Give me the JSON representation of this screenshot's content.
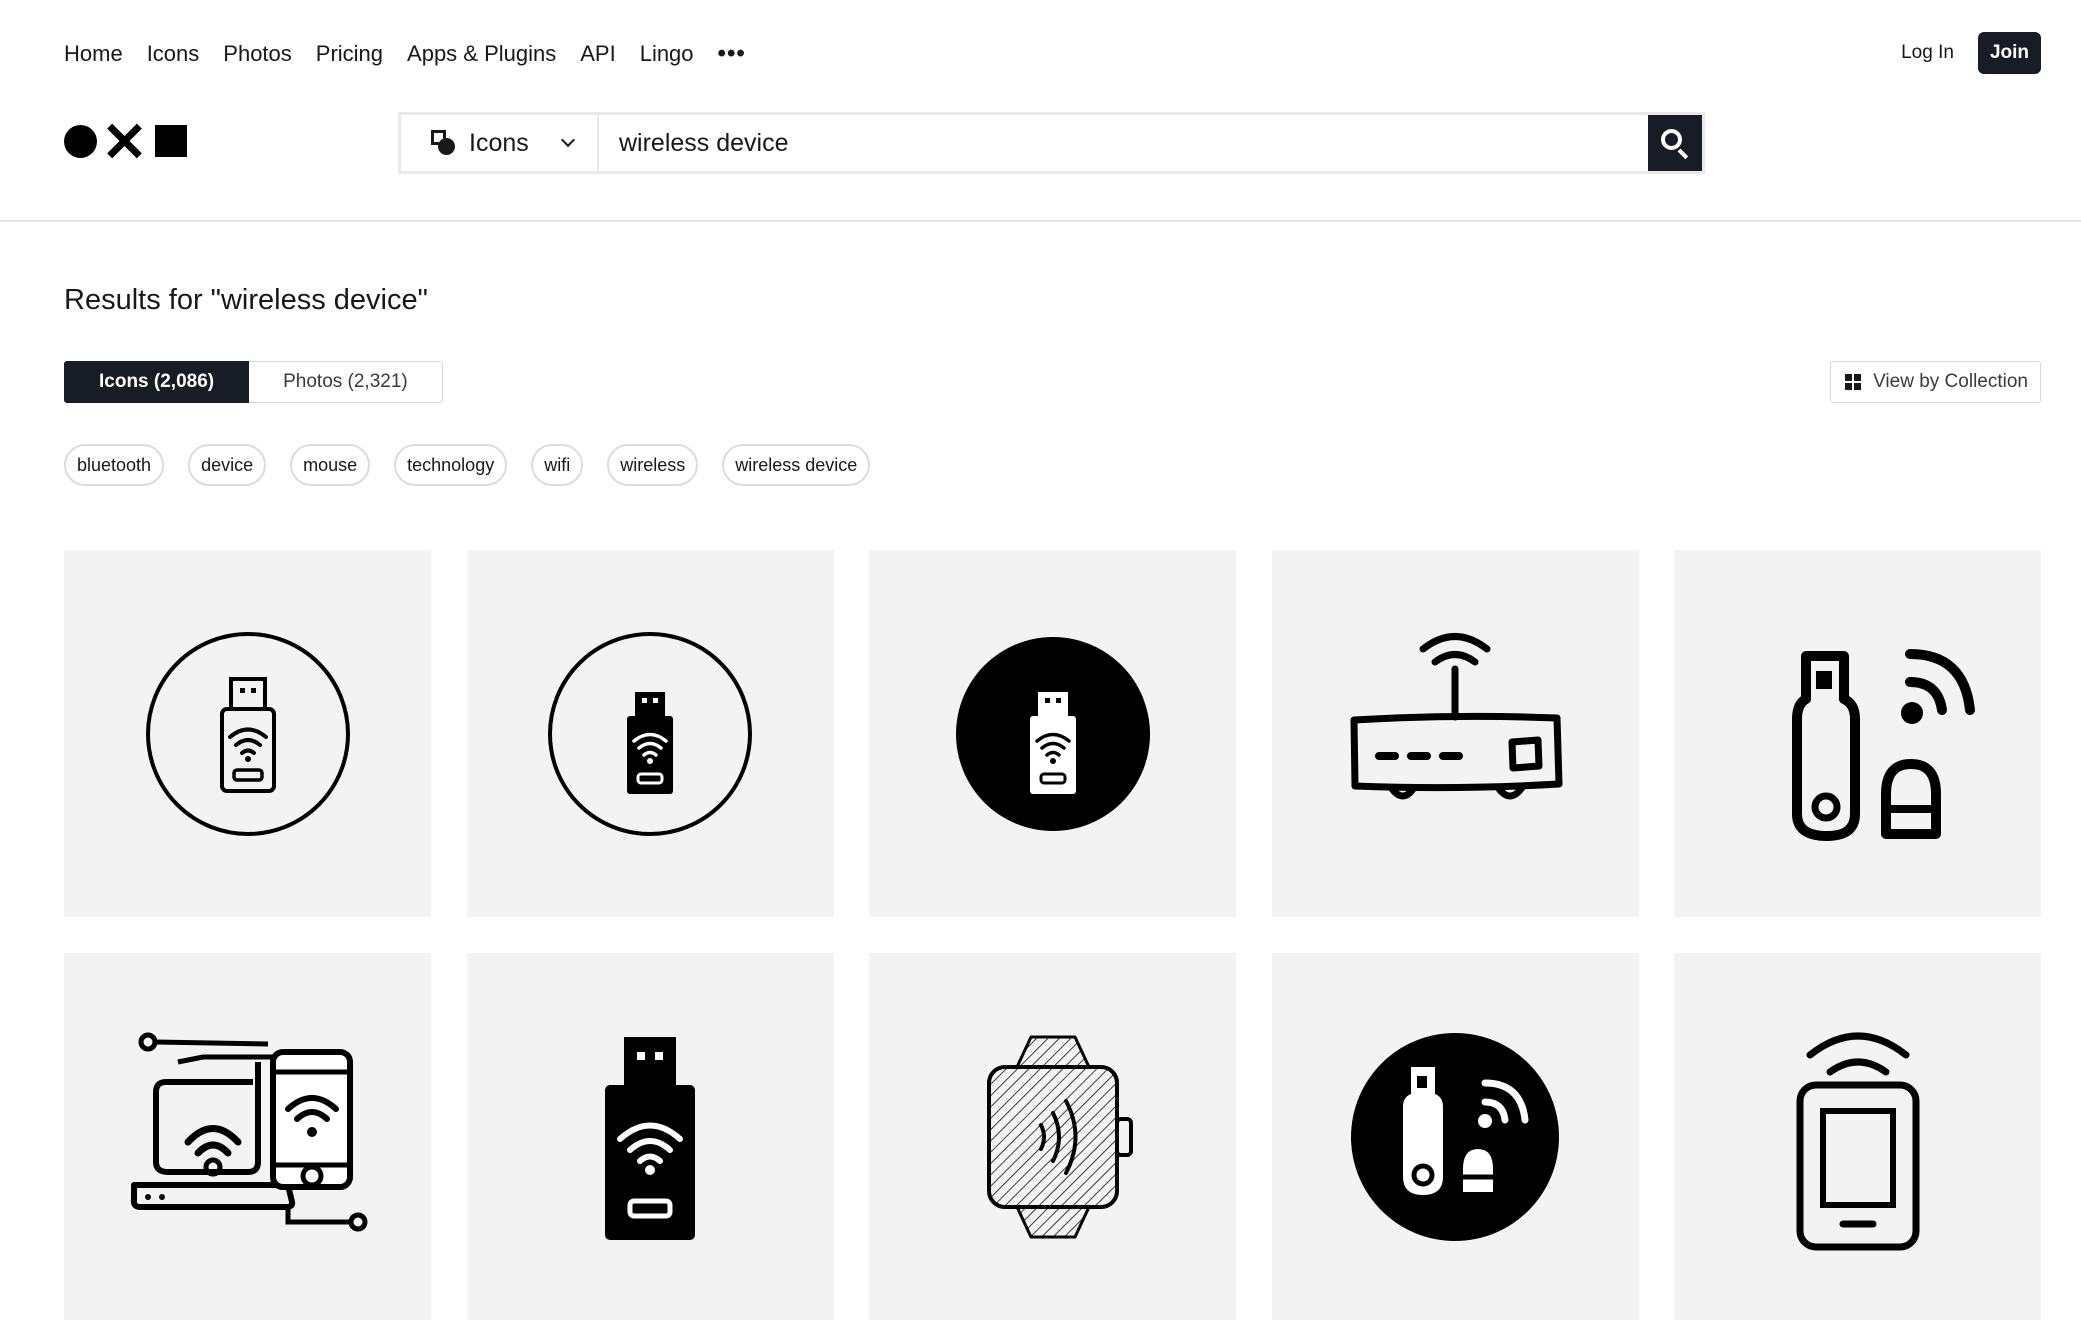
{
  "nav": {
    "items": [
      "Home",
      "Icons",
      "Photos",
      "Pricing",
      "Apps & Plugins",
      "API",
      "Lingo"
    ],
    "more_label": "•••",
    "login_label": "Log In",
    "join_label": "Join"
  },
  "search": {
    "scope_label": "Icons",
    "query": "wireless device"
  },
  "results": {
    "title": "Results for \"wireless device\"",
    "tabs": [
      {
        "label": "Icons (2,086)",
        "active": true
      },
      {
        "label": "Photos (2,321)",
        "active": false
      }
    ],
    "view_by_collection_label": "View by Collection"
  },
  "chips": [
    "bluetooth",
    "device",
    "mouse",
    "technology",
    "wifi",
    "wireless",
    "wireless device"
  ],
  "icons": [
    "usb-wifi-dongle-outline-circle-icon",
    "usb-wifi-dongle-filled-circle-outline-icon",
    "usb-wifi-dongle-black-circle-icon",
    "wireless-router-icon",
    "usb-dongle-signal-icon",
    "laptop-phone-wifi-circuit-icon",
    "usb-wifi-stick-icon",
    "smartwatch-wireless-hatched-icon",
    "usb-dongle-signal-black-circle-icon",
    "phone-wireless-signal-icon"
  ],
  "colors": {
    "dark": "#181c26",
    "tile_bg": "#f3f3f4",
    "border": "#d6d6d8"
  }
}
